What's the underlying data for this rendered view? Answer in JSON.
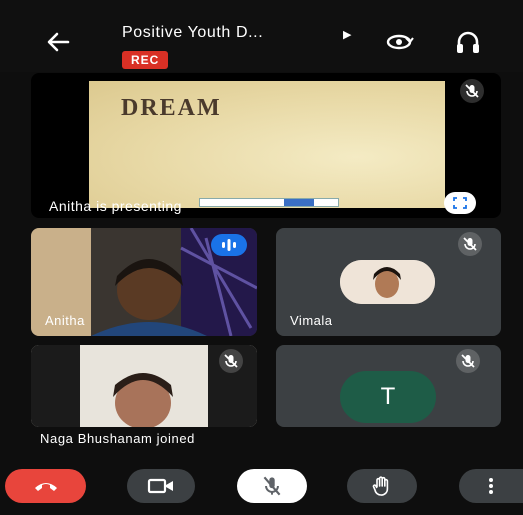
{
  "header": {
    "title": "Positive Youth D...",
    "rec_badge": "REC",
    "back_icon": "arrow-left-icon",
    "camera_switch_icon": "switch-camera-icon",
    "audio_output_icon": "headphones-icon"
  },
  "presentation": {
    "slide_title": "DREAM",
    "label": "Anitha is presenting"
  },
  "participants": [
    {
      "name": "Anitha",
      "muted": false
    },
    {
      "name": "Vimala",
      "muted": true
    },
    {
      "name": "",
      "muted": true
    },
    {
      "avatar_letter": "T",
      "muted": true
    }
  ],
  "notification": "Naga Bhushanam joined",
  "controls": {
    "end_call_icon": "phone-hangup-icon",
    "camera_icon": "video-camera-icon",
    "mic_icon": "mic-off-icon",
    "raise_hand_icon": "raise-hand-icon",
    "more_icon": "more-vertical-icon"
  },
  "colors": {
    "end_call": "#e8453c",
    "rec": "#d93025",
    "speaking": "#1a73e8",
    "avatar_T": "#1e5c47"
  }
}
